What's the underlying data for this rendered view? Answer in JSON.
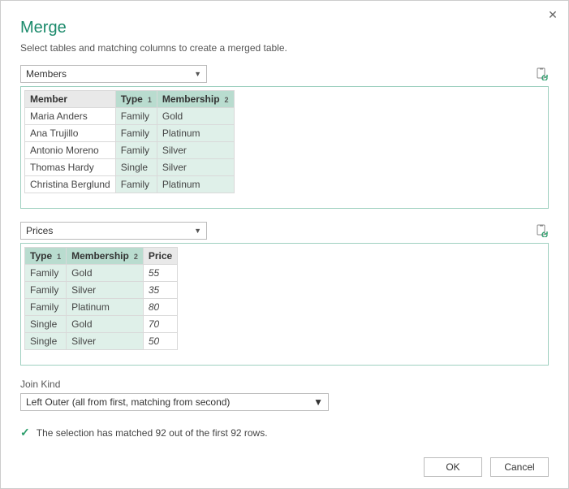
{
  "title": "Merge",
  "subtitle": "Select tables and matching columns to create a merged table.",
  "table1": {
    "name": "Members",
    "columns": [
      {
        "label": "Member",
        "selected": false,
        "badge": ""
      },
      {
        "label": "Type",
        "selected": true,
        "badge": "1"
      },
      {
        "label": "Membership",
        "selected": true,
        "badge": "2"
      }
    ],
    "rows": [
      [
        "Maria Anders",
        "Family",
        "Gold"
      ],
      [
        "Ana Trujillo",
        "Family",
        "Platinum"
      ],
      [
        "Antonio Moreno",
        "Family",
        "Silver"
      ],
      [
        "Thomas Hardy",
        "Single",
        "Silver"
      ],
      [
        "Christina Berglund",
        "Family",
        "Platinum"
      ]
    ]
  },
  "table2": {
    "name": "Prices",
    "columns": [
      {
        "label": "Type",
        "selected": true,
        "badge": "1"
      },
      {
        "label": "Membership",
        "selected": true,
        "badge": "2"
      },
      {
        "label": "Price",
        "selected": false,
        "badge": ""
      }
    ],
    "rows": [
      [
        "Family",
        "Gold",
        "55"
      ],
      [
        "Family",
        "Silver",
        "35"
      ],
      [
        "Family",
        "Platinum",
        "80"
      ],
      [
        "Single",
        "Gold",
        "70"
      ],
      [
        "Single",
        "Silver",
        "50"
      ]
    ],
    "numericCols": [
      2
    ]
  },
  "joinKind": {
    "label": "Join Kind",
    "value": "Left Outer (all from first, matching from second)"
  },
  "status": "The selection has matched 92 out of the first 92 rows.",
  "buttons": {
    "ok": "OK",
    "cancel": "Cancel"
  }
}
